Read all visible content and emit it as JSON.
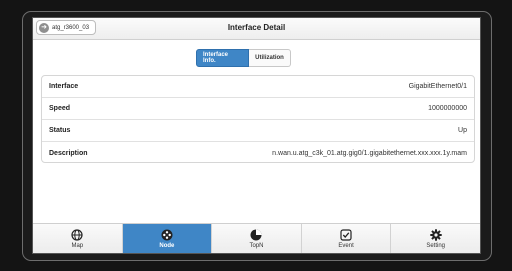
{
  "header": {
    "back_label": "atg_r3600_03",
    "title": "Interface Detail"
  },
  "segments": {
    "active_label": "Interface Info.",
    "inactive_label": "Utilization"
  },
  "details": [
    {
      "label": "Interface",
      "value": "GigabitEthernet0/1"
    },
    {
      "label": "Speed",
      "value": "1000000000"
    },
    {
      "label": "Status",
      "value": "Up"
    },
    {
      "label": "Description",
      "value": "n.wan.u.atg_c3k_01.atg.gig0/1.gigabitethernet.xxx.xxx.1y.mam"
    }
  ],
  "tabs": [
    {
      "label": "Map",
      "icon": "globe-icon"
    },
    {
      "label": "Node",
      "icon": "node-icon",
      "active": true
    },
    {
      "label": "TopN",
      "icon": "pie-icon"
    },
    {
      "label": "Event",
      "icon": "event-check-icon"
    },
    {
      "label": "Setting",
      "icon": "gear-icon"
    }
  ],
  "colors": {
    "accent": "#3f86c6"
  }
}
